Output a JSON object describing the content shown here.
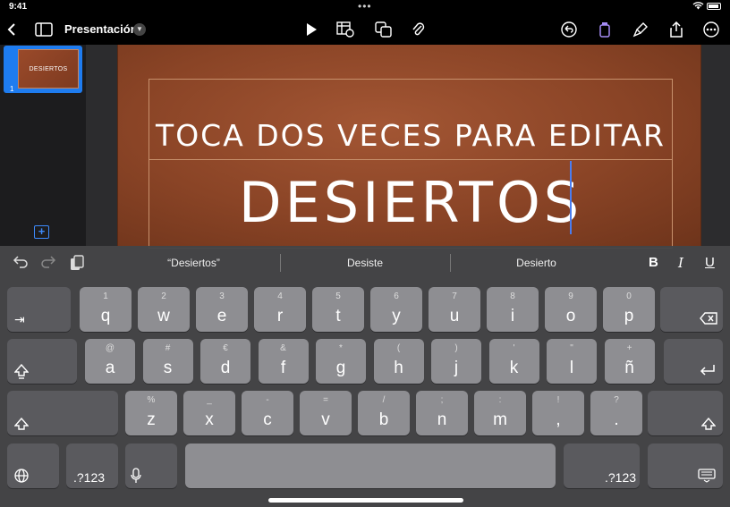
{
  "status": {
    "time": "9:41"
  },
  "toolbar": {
    "title": "Presentación"
  },
  "navigator": {
    "slides": [
      {
        "number": "1",
        "thumb_text": "DESIERTOS"
      }
    ]
  },
  "slide": {
    "subtitle": "TOCA DOS VECES PARA EDITAR",
    "title": "DESIERTOS"
  },
  "suggestions": {
    "words": [
      "“Desiertos”",
      "Desiste",
      "Desierto"
    ],
    "bold": "B",
    "italic": "I",
    "underline": "U"
  },
  "keyboard": {
    "row1": [
      {
        "alt": "1",
        "main": "q"
      },
      {
        "alt": "2",
        "main": "w"
      },
      {
        "alt": "3",
        "main": "e"
      },
      {
        "alt": "4",
        "main": "r"
      },
      {
        "alt": "5",
        "main": "t"
      },
      {
        "alt": "6",
        "main": "y"
      },
      {
        "alt": "7",
        "main": "u"
      },
      {
        "alt": "8",
        "main": "i"
      },
      {
        "alt": "9",
        "main": "o"
      },
      {
        "alt": "0",
        "main": "p"
      }
    ],
    "row2": [
      {
        "alt": "@",
        "main": "a"
      },
      {
        "alt": "#",
        "main": "s"
      },
      {
        "alt": "€",
        "main": "d"
      },
      {
        "alt": "&",
        "main": "f"
      },
      {
        "alt": "*",
        "main": "g"
      },
      {
        "alt": "(",
        "main": "h"
      },
      {
        "alt": ")",
        "main": "j"
      },
      {
        "alt": "'",
        "main": "k"
      },
      {
        "alt": "\"",
        "main": "l"
      },
      {
        "alt": "+",
        "main": "ñ"
      }
    ],
    "row3": [
      {
        "alt": "%",
        "main": "z"
      },
      {
        "alt": "_",
        "main": "x"
      },
      {
        "alt": "-",
        "main": "c"
      },
      {
        "alt": "=",
        "main": "v"
      },
      {
        "alt": "/",
        "main": "b"
      },
      {
        "alt": ";",
        "main": "n"
      },
      {
        "alt": ":",
        "main": "m"
      },
      {
        "alt": "!",
        "main": ","
      },
      {
        "alt": "?",
        "main": "."
      }
    ],
    "numbers_label": ".?123"
  }
}
